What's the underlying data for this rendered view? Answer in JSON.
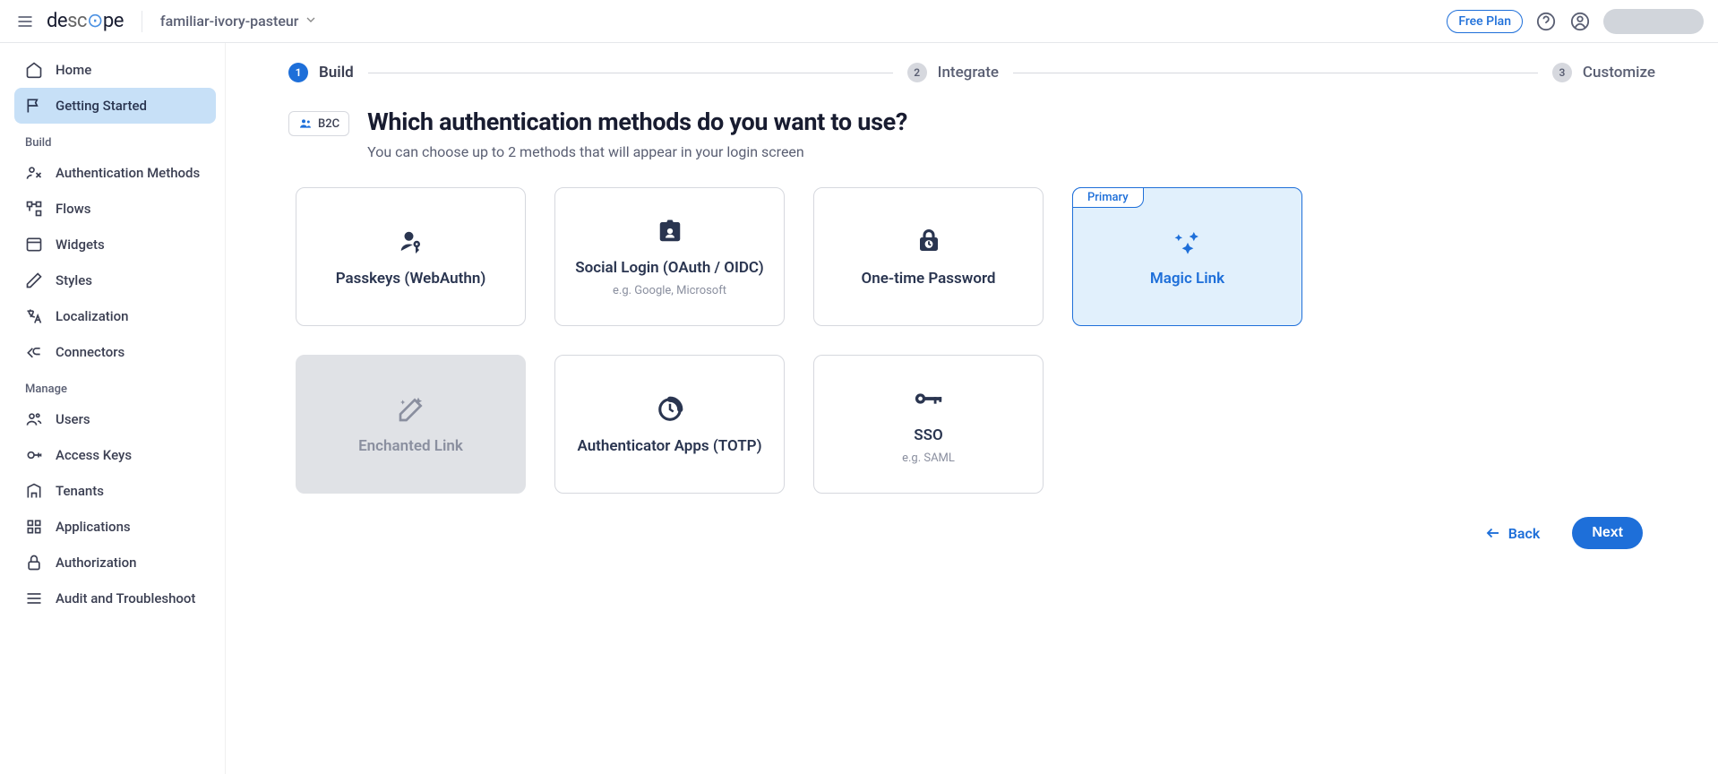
{
  "header": {
    "project_name": "familiar-ivory-pasteur",
    "free_plan": "Free Plan"
  },
  "sidebar": {
    "items": [
      {
        "label": "Home",
        "icon": "home"
      },
      {
        "label": "Getting Started",
        "icon": "flag",
        "active": true
      }
    ],
    "build_section": "Build",
    "build_items": [
      {
        "label": "Authentication Methods",
        "icon": "auth"
      },
      {
        "label": "Flows",
        "icon": "flows"
      },
      {
        "label": "Widgets",
        "icon": "widgets"
      },
      {
        "label": "Styles",
        "icon": "styles"
      },
      {
        "label": "Localization",
        "icon": "localization"
      },
      {
        "label": "Connectors",
        "icon": "connectors"
      }
    ],
    "manage_section": "Manage",
    "manage_items": [
      {
        "label": "Users",
        "icon": "users"
      },
      {
        "label": "Access Keys",
        "icon": "access-keys"
      },
      {
        "label": "Tenants",
        "icon": "tenants"
      },
      {
        "label": "Applications",
        "icon": "applications"
      },
      {
        "label": "Authorization",
        "icon": "authorization"
      },
      {
        "label": "Audit and Troubleshoot",
        "icon": "audit"
      }
    ]
  },
  "stepper": {
    "steps": [
      {
        "num": "1",
        "label": "Build",
        "active": true
      },
      {
        "num": "2",
        "label": "Integrate",
        "active": false
      },
      {
        "num": "3",
        "label": "Customize",
        "active": false
      }
    ]
  },
  "page": {
    "badge": "B2C",
    "title": "Which authentication methods do you want to use?",
    "subtitle": "You can choose up to 2 methods that will appear in your login screen"
  },
  "cards": [
    {
      "title": "Passkeys (WebAuthn)",
      "sub": "",
      "icon": "passkey",
      "state": "normal"
    },
    {
      "title": "Social Login (OAuth / OIDC)",
      "sub": "e.g. Google, Microsoft",
      "icon": "social",
      "state": "normal"
    },
    {
      "title": "One-time Password",
      "sub": "",
      "icon": "otp",
      "state": "normal"
    },
    {
      "title": "Magic Link",
      "sub": "",
      "icon": "magic",
      "state": "selected",
      "badge": "Primary"
    },
    {
      "title": "Enchanted Link",
      "sub": "",
      "icon": "enchanted",
      "state": "disabled"
    },
    {
      "title": "Authenticator Apps (TOTP)",
      "sub": "",
      "icon": "totp",
      "state": "normal"
    },
    {
      "title": "SSO",
      "sub": "e.g. SAML",
      "icon": "sso",
      "state": "normal"
    }
  ],
  "footer": {
    "back": "Back",
    "next": "Next"
  }
}
